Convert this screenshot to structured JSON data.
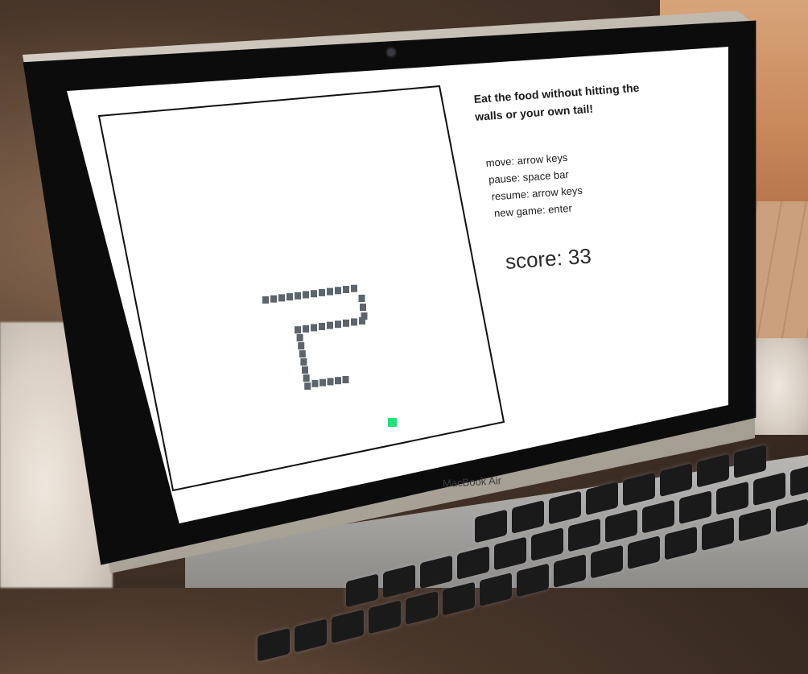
{
  "screen": {
    "instructions": "Eat the food without hitting the walls or your own tail!",
    "controls": [
      "move: arrow keys",
      "pause: space bar",
      "resume: arrow keys",
      "new game: enter"
    ],
    "score_label": "score: 33"
  },
  "game": {
    "score": 33,
    "snake_color": "#5c646c",
    "food_color": "#22e07a",
    "board_border_color": "#111111"
  },
  "laptop": {
    "brand": "MacBook Air"
  }
}
